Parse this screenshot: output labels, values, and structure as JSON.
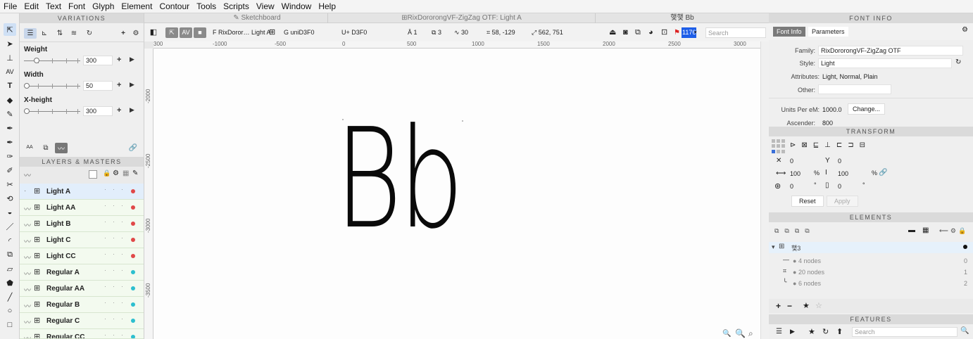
{
  "menu": [
    "File",
    "Edit",
    "Text",
    "Font",
    "Glyph",
    "Element",
    "Contour",
    "Tools",
    "Scripts",
    "View",
    "Window",
    "Help"
  ],
  "tabs": {
    "sketchboard": "Sketchboard",
    "font": "RixDororongVF-ZigZag OTF: Light A",
    "glyph": "햋햋 Bb"
  },
  "variations": {
    "header": "VARIATIONS",
    "axes": [
      {
        "name": "Weight",
        "value": "300",
        "fraction": 0.2
      },
      {
        "name": "Width",
        "value": "50",
        "fraction": 0.0
      },
      {
        "name": "X-height",
        "value": "300",
        "fraction": 0.0
      }
    ],
    "mode_labels": [
      "AA"
    ]
  },
  "layers": {
    "header": "LAYERS & MASTERS",
    "items": [
      {
        "name": "Light A",
        "color": "#e04848",
        "selected": true
      },
      {
        "name": "Light AA",
        "color": "#e04848"
      },
      {
        "name": "Light B",
        "color": "#e04848"
      },
      {
        "name": "Light C",
        "color": "#e04848"
      },
      {
        "name": "Light CC",
        "color": "#e04848"
      },
      {
        "name": "Regular A",
        "color": "#2cbfcf"
      },
      {
        "name": "Regular AA",
        "color": "#2cbfcf"
      },
      {
        "name": "Regular B",
        "color": "#2cbfcf"
      },
      {
        "name": "Regular C",
        "color": "#2cbfcf"
      },
      {
        "name": "Regular CC",
        "color": "#2cbfcf"
      }
    ]
  },
  "toolbar": {
    "font_name": "F RixDoror… Light A",
    "glyph_name": "uniD3F0",
    "unicode": "U+ D3F0",
    "contours": "1",
    "elements": "3",
    "points": "30",
    "coords": "58, -129",
    "size": "562, 751",
    "color_value": "1176",
    "search_placeholder": "Search"
  },
  "ruler": [
    "300",
    "-1000",
    "-500",
    "0",
    "500",
    "1000",
    "1500",
    "2000",
    "2500",
    "3000"
  ],
  "vruler": [
    "-2000",
    "-2500",
    "-3000",
    "-3500"
  ],
  "canvas": {
    "glyph_text": "Bb"
  },
  "font_info": {
    "header": "FONT INFO",
    "tab_fontinfo": "Font Info",
    "tab_parameters": "Parameters",
    "family_label": "Family:",
    "family": "RixDororongVF-ZigZag OTF",
    "style_label": "Style:",
    "style": "Light",
    "attributes_label": "Attributes:",
    "attributes": "Light, Normal, Plain",
    "other_label": "Other:",
    "upm_label": "Units Per eM:",
    "upm": "1000.0",
    "change_button": "Change...",
    "ascender_label": "Ascender:",
    "ascender": "800"
  },
  "transform": {
    "header": "TRANSFORM",
    "x": "0",
    "y": "0",
    "w": "100",
    "h": "100",
    "pct": "%",
    "rot": "0",
    "skew": "0",
    "deg": "°",
    "reset": "Reset",
    "apply": "Apply"
  },
  "elements": {
    "header": "ELEMENTS",
    "glyph_row": "햋3",
    "rows": [
      {
        "label": "4 nodes",
        "index": "0"
      },
      {
        "label": "20 nodes",
        "index": "1"
      },
      {
        "label": "6 nodes",
        "index": "2"
      }
    ]
  },
  "features": {
    "header": "FEATURES",
    "search_placeholder": "Search"
  }
}
